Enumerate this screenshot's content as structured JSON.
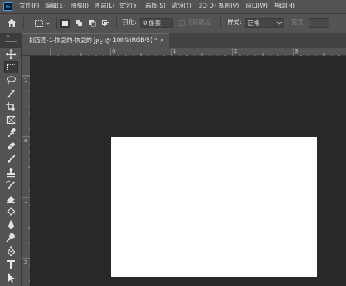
{
  "app": {
    "logo_text": "Ps"
  },
  "menu": {
    "items": [
      "文件(F)",
      "编辑(E)",
      "图像(I)",
      "图层(L)",
      "文字(Y)",
      "选择(S)",
      "滤镜(T)",
      "3D(D)",
      "视图(V)",
      "窗口(W)",
      "帮助(H)"
    ]
  },
  "options_bar": {
    "feather_label": "羽化:",
    "feather_value": "0 像素",
    "antialias_label": "消除锯齿",
    "style_label": "样式:",
    "style_value": "正常",
    "width_label": "宽度:"
  },
  "tab": {
    "title": "封面图-1-恢复的-恢复的.jpg @ 100%(RGB/8) *",
    "close": "×"
  },
  "ruler_h_labels": [
    "0",
    "1",
    "2",
    "3"
  ],
  "ruler_v_labels": [
    "1",
    "0",
    "1",
    "2"
  ],
  "tools": [
    "move-tool",
    "rect-marquee-tool",
    "lasso-tool",
    "magic-wand-tool",
    "crop-tool",
    "frame-tool",
    "eyedropper-tool",
    "healing-brush-tool",
    "brush-tool",
    "clone-stamp-tool",
    "history-brush-tool",
    "eraser-tool",
    "paint-bucket-tool",
    "blur-tool",
    "dodge-tool",
    "pen-tool",
    "type-tool",
    "path-selection-tool"
  ],
  "colors": {
    "menubar": "#535353",
    "workspace": "#282828",
    "canvas": "#ffffff",
    "accent": "#31a8ff"
  }
}
